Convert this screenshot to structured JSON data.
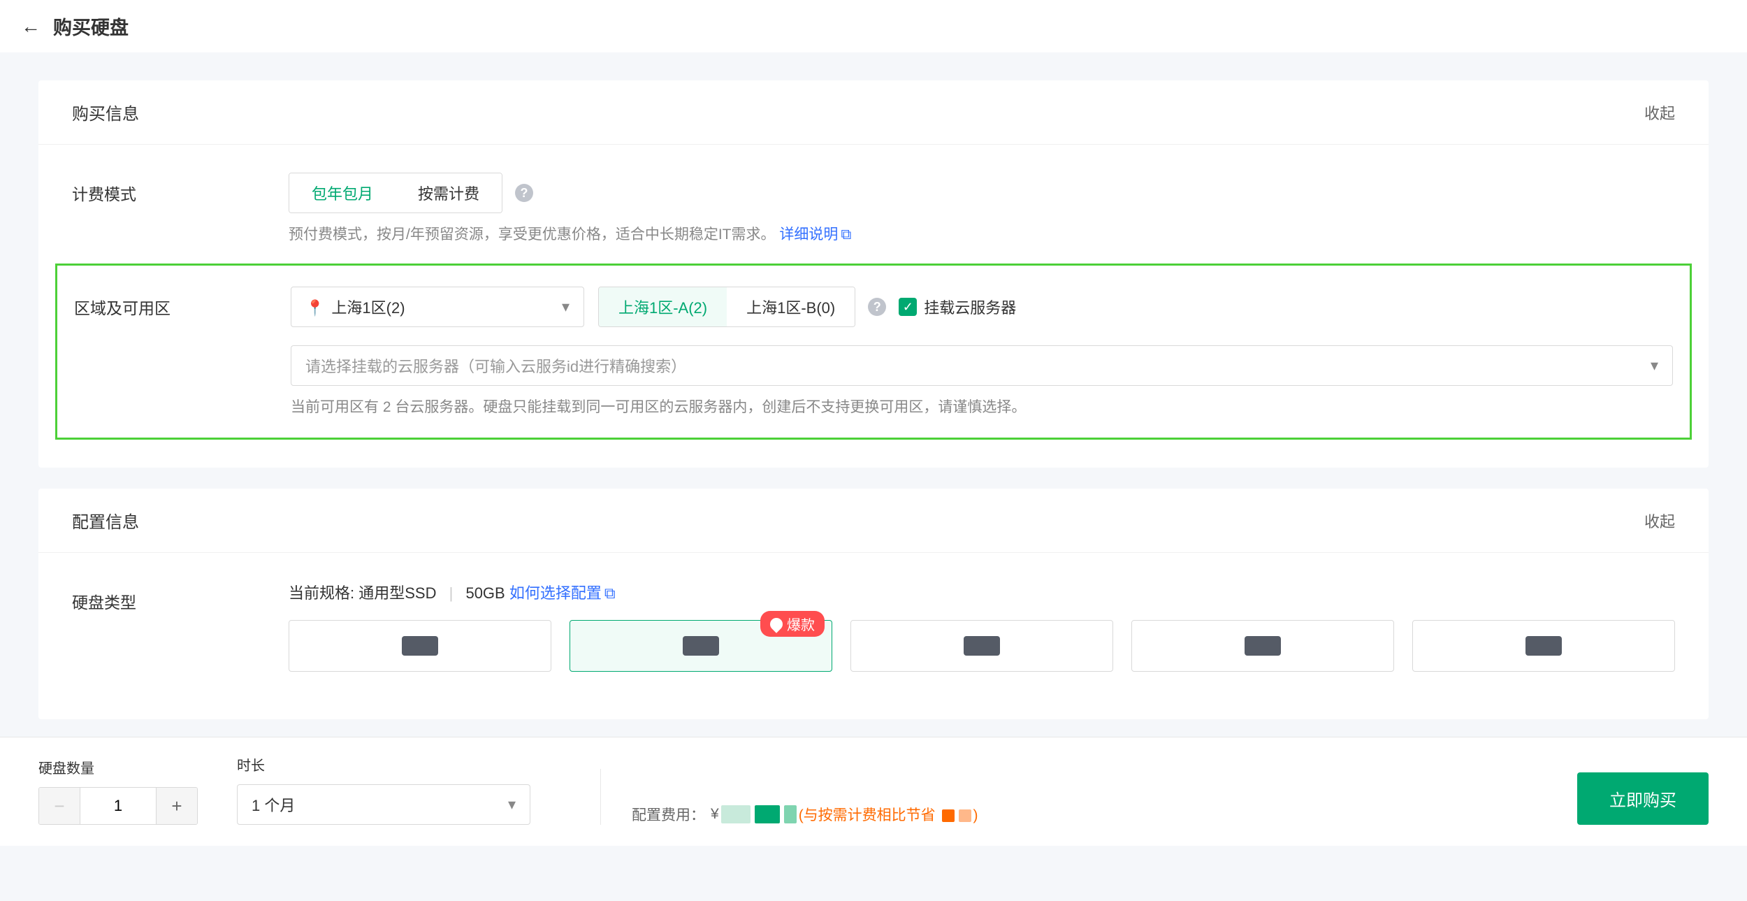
{
  "header": {
    "title": "购买硬盘"
  },
  "purchase": {
    "title": "购买信息",
    "collapse": "收起",
    "billing": {
      "label": "计费模式",
      "options": [
        "包年包月",
        "按需计费"
      ],
      "hint_prefix": "预付费模式，按月/年预留资源，享受更优惠价格，适合中长期稳定IT需求。",
      "hint_link": "详细说明"
    },
    "region": {
      "label": "区域及可用区",
      "region_value": "上海1区(2)",
      "zones": [
        "上海1区-A(2)",
        "上海1区-B(0)"
      ],
      "mount_label": "挂载云服务器",
      "server_placeholder": "请选择挂载的云服务器（可输入云服务id进行精确搜索）",
      "hint": "当前可用区有 2 台云服务器。硬盘只能挂载到同一可用区的云服务器内，创建后不支持更换可用区，请谨慎选择。"
    }
  },
  "config": {
    "title": "配置信息",
    "collapse": "收起",
    "disk_type": {
      "label": "硬盘类型",
      "spec_prefix": "当前规格: ",
      "spec_value": "通用型SSD",
      "spec_size": "50GB",
      "spec_link": "如何选择配置",
      "hot_badge": "爆款"
    }
  },
  "footer": {
    "qty_label": "硬盘数量",
    "qty_value": "1",
    "duration_label": "时长",
    "duration_value": "1 个月",
    "cost_label": "配置费用：",
    "cost_currency": "¥",
    "save_prefix": "(与按需计费相比节省 ",
    "save_suffix": ")",
    "buy_btn": "立即购买"
  }
}
